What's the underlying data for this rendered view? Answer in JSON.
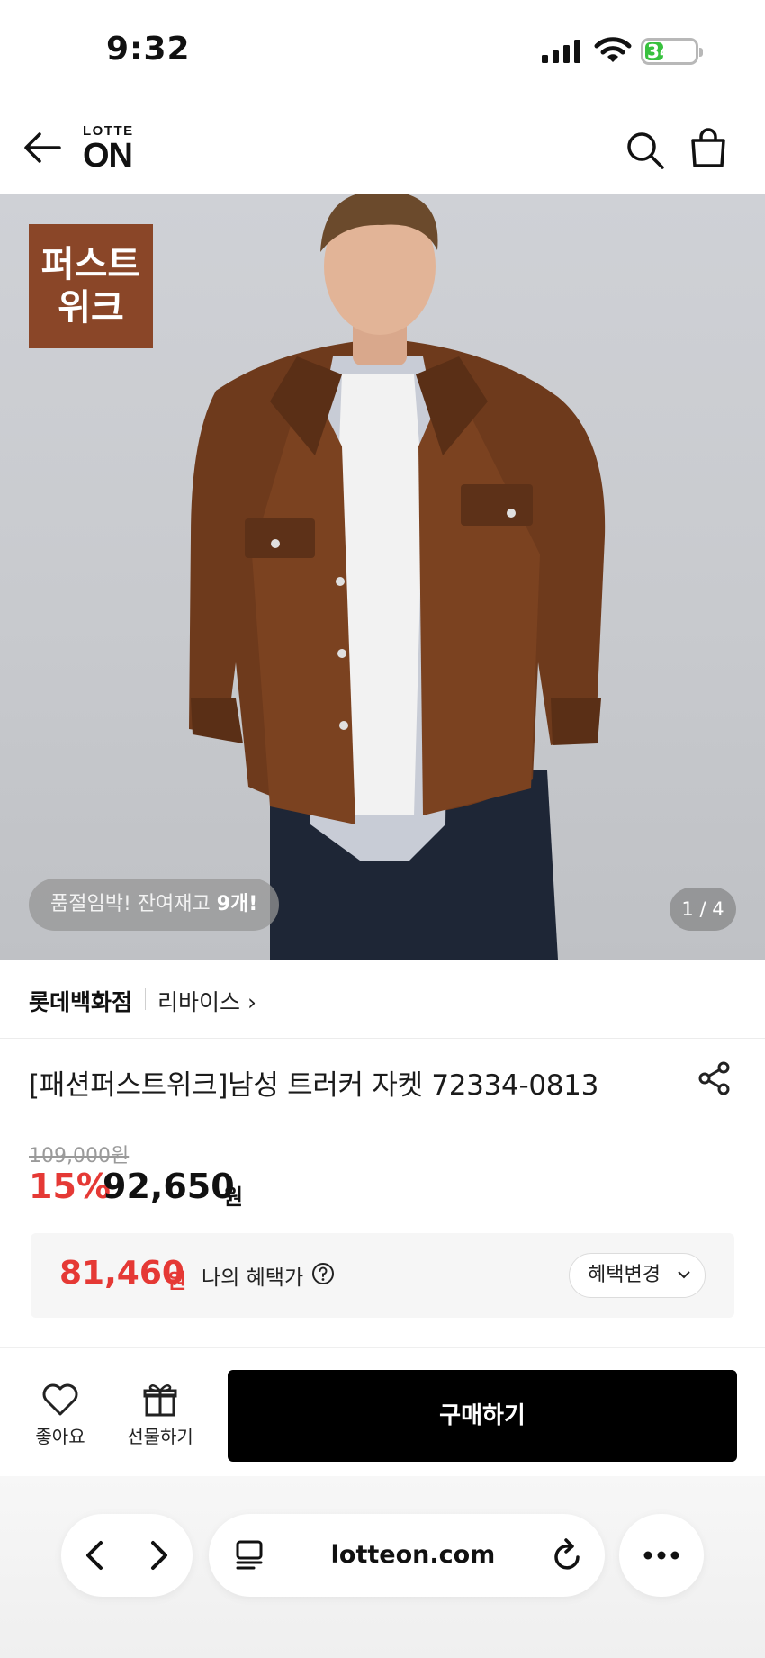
{
  "status_bar": {
    "time": "9:32",
    "battery": "34",
    "battery_level": 0.34
  },
  "header": {
    "logo_top": "LOTTE",
    "logo_main": "ON"
  },
  "hero": {
    "badge_line1": "퍼스트",
    "badge_line2": "위크",
    "stock_prefix": "품절임박! 잔여재고 ",
    "stock_count": "9개!",
    "page_indicator": "1 / 4"
  },
  "store": {
    "name": "롯데백화점",
    "brand": "리바이스 ›"
  },
  "product": {
    "title": "[패션퍼스트위크]남성 트러커 자켓 72334-0813"
  },
  "price": {
    "original": "109,000원",
    "discount_rate": "15%",
    "sale_price": "92,650",
    "unit": "원"
  },
  "benefit": {
    "price": "81,460",
    "unit": "원",
    "label": "나의 혜택가",
    "change_button": "혜택변경"
  },
  "actions": {
    "like_label": "좋아요",
    "gift_label": "선물하기",
    "buy_label": "구매하기"
  },
  "browser": {
    "url": "lotteon.com"
  },
  "colors": {
    "accent_red": "#e53935",
    "badge_brown": "#8a4628",
    "buy_black": "#000000"
  }
}
